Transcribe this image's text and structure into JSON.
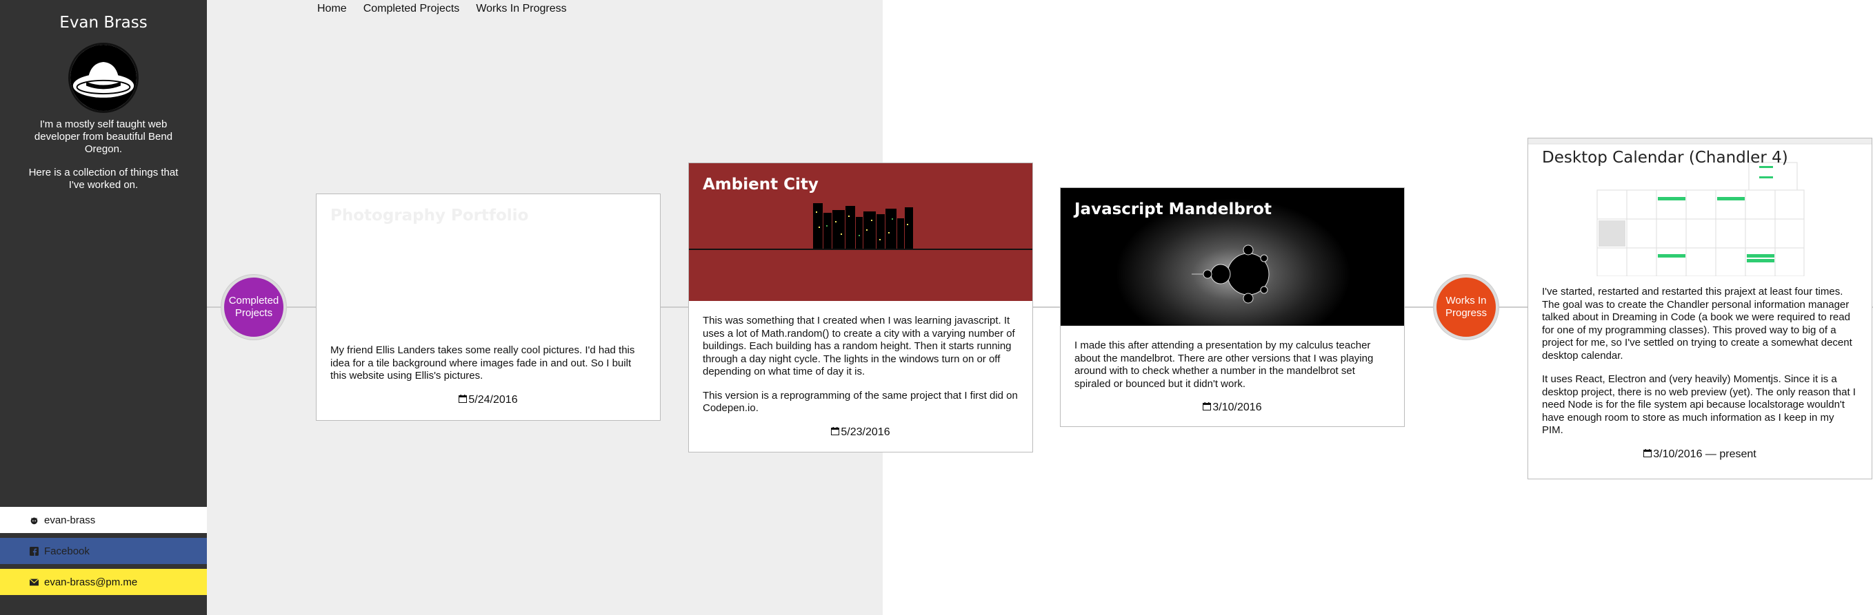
{
  "sidebar": {
    "name": "Evan Brass",
    "bio": [
      "I'm a mostly self taught web developer from beautiful Bend Oregon.",
      "Here is a collection of things that I've worked on."
    ],
    "links": [
      {
        "icon": "github-icon",
        "label": "evan-brass"
      },
      {
        "icon": "facebook-icon",
        "label": "Facebook"
      },
      {
        "icon": "envelope-icon",
        "label": "evan-brass@pm.me"
      }
    ]
  },
  "nav": [
    "Home",
    "Completed Projects",
    "Works In Progress"
  ],
  "markers": {
    "completed": "Completed Projects",
    "progress": "Works In Progress"
  },
  "cards": [
    {
      "title": "Photography Portfolio",
      "paragraphs": [
        "My friend Ellis Landers takes some really cool pictures. I'd had this idea for a tile background where images fade in and out. So I built this website using Ellis's pictures."
      ],
      "date": "5/24/2016"
    },
    {
      "title": "Ambient City",
      "paragraphs": [
        "This was something that I created when I was learning javascript. It uses a lot of Math.random() to create a city with a varying number of buildings. Each building has a random height. Then it starts running through a day night cycle. The lights in the windows turn on or off depending on what time of day it is.",
        "This version is a reprogramming of the same project that I first did on Codepen.io."
      ],
      "date": "5/23/2016"
    },
    {
      "title": "Javascript Mandelbrot",
      "paragraphs": [
        "I made this after attending a presentation by my calculus teacher about the mandelbrot. There are other versions that I was playing around with to check whether a number in the mandelbrot set spiraled or bounced but it didn't work."
      ],
      "date": "3/10/2016"
    },
    {
      "title": "Desktop Calendar (Chandler 4)",
      "paragraphs": [
        "I've started, restarted and restarted this prajext at least four times. The goal was to create the Chandler personal information manager talked about in Dreaming in Code (a book we were required to read for one of my programming classes). This proved way to big of a project for me, so I've settled on trying to create a somewhat decent desktop calendar.",
        "It uses React, Electron and (very heavily) Momentjs. Since it is a desktop project, there is no web preview (yet). The only reason that I need Node is for the file system api because localstorage wouldn't have enough room to store as much information as I keep in my PIM."
      ],
      "date": "3/10/2016 — present"
    }
  ],
  "colors": {
    "sidebar": "#333333",
    "completed": "#9c27b0",
    "progress": "#e64a19",
    "city": "#922b2b",
    "facebook": "#3b5998",
    "email": "#ffeb3b"
  }
}
